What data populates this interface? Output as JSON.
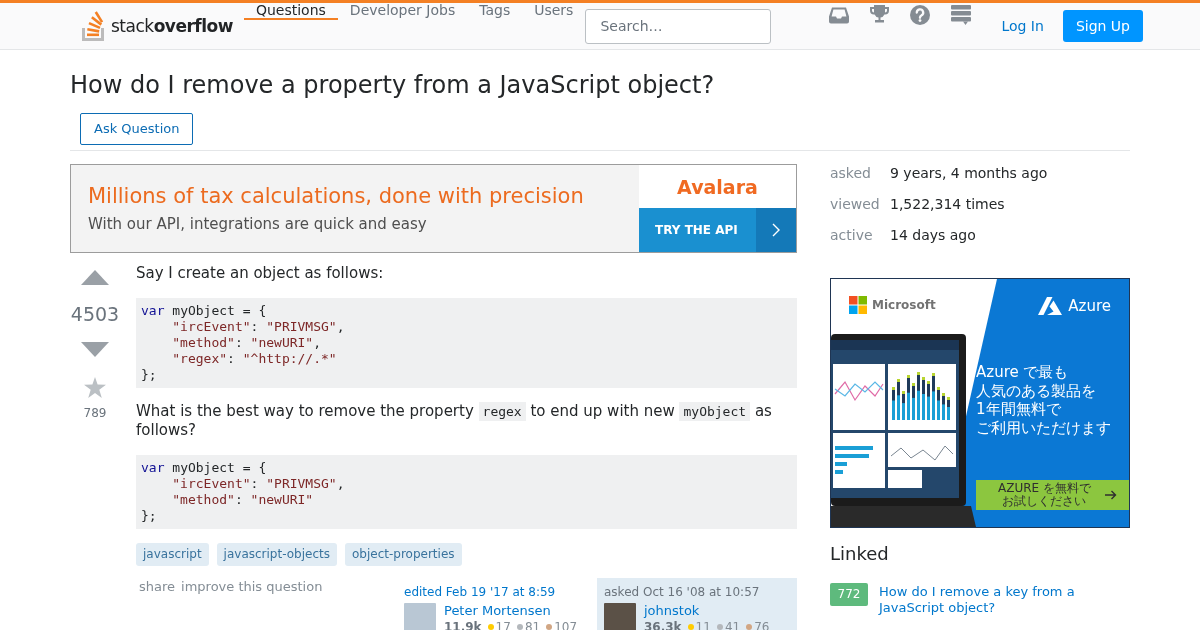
{
  "header": {
    "logo_text": "stack**overflow**",
    "nav": [
      {
        "label": "Questions",
        "selected": true
      },
      {
        "label": "Developer Jobs",
        "selected": false
      },
      {
        "label": "Tags",
        "selected": false
      },
      {
        "label": "Users",
        "selected": false
      }
    ],
    "search": {
      "placeholder": "Search…"
    },
    "login": "Log In",
    "signup": "Sign Up"
  },
  "question": {
    "title": "How do I remove a property from a JavaScript object?",
    "ask_button": "Ask Question"
  },
  "ad_banner": {
    "headline": "Millions of tax calculations, done with precision",
    "subline": "With our API, integrations are quick and easy",
    "brand": "Avalara",
    "cta": "TRY THE API"
  },
  "post": {
    "score": "4503",
    "favorite_count": "789",
    "body": [
      {
        "kind": "paragraph",
        "parts": [
          {
            "kind": "text",
            "text": "Say I create an object as follows:"
          }
        ]
      },
      {
        "kind": "code",
        "lines": [
          {
            "indent": false,
            "tokens": [
              {
                "kind": "keyword",
                "text": "var"
              },
              {
                "kind": "plain",
                "text": " myObject = {"
              }
            ]
          },
          {
            "indent": true,
            "tokens": [
              {
                "kind": "string",
                "text": "\"ircEvent\""
              },
              {
                "kind": "plain",
                "text": ": "
              },
              {
                "kind": "string",
                "text": "\"PRIVMSG\""
              },
              {
                "kind": "plain",
                "text": ","
              }
            ]
          },
          {
            "indent": true,
            "tokens": [
              {
                "kind": "string",
                "text": "\"method\""
              },
              {
                "kind": "plain",
                "text": ": "
              },
              {
                "kind": "string",
                "text": "\"newURI\""
              },
              {
                "kind": "plain",
                "text": ","
              }
            ]
          },
          {
            "indent": true,
            "tokens": [
              {
                "kind": "string",
                "text": "\"regex\""
              },
              {
                "kind": "plain",
                "text": ": "
              },
              {
                "kind": "string",
                "text": "\"^http://.*\""
              }
            ]
          },
          {
            "indent": false,
            "tokens": [
              {
                "kind": "plain",
                "text": "};"
              }
            ]
          }
        ]
      },
      {
        "kind": "paragraph",
        "parts": [
          {
            "kind": "text",
            "text": "What is the best way to remove the property "
          },
          {
            "kind": "code",
            "text": "regex"
          },
          {
            "kind": "text",
            "text": " to end up with new "
          },
          {
            "kind": "code",
            "text": "myObject"
          },
          {
            "kind": "text",
            "text": " as follows?"
          }
        ]
      },
      {
        "kind": "code",
        "lines": [
          {
            "indent": false,
            "tokens": [
              {
                "kind": "keyword",
                "text": "var"
              },
              {
                "kind": "plain",
                "text": " myObject = {"
              }
            ]
          },
          {
            "indent": true,
            "tokens": [
              {
                "kind": "string",
                "text": "\"ircEvent\""
              },
              {
                "kind": "plain",
                "text": ": "
              },
              {
                "kind": "string",
                "text": "\"PRIVMSG\""
              },
              {
                "kind": "plain",
                "text": ","
              }
            ]
          },
          {
            "indent": true,
            "tokens": [
              {
                "kind": "string",
                "text": "\"method\""
              },
              {
                "kind": "plain",
                "text": ": "
              },
              {
                "kind": "string",
                "text": "\"newURI\""
              }
            ]
          },
          {
            "indent": false,
            "tokens": [
              {
                "kind": "plain",
                "text": "};"
              }
            ]
          }
        ]
      }
    ],
    "tags": [
      "javascript",
      "javascript-objects",
      "object-properties"
    ],
    "menu": [
      "share",
      "improve this question"
    ],
    "user_cards": [
      {
        "kind": "editor",
        "action": "edited Feb 19 '17 at 8:59",
        "name": "Peter Mortensen",
        "reputation": "11.9k",
        "badges": [
          {
            "color": "#ffcc01",
            "count": "17"
          },
          {
            "color": "#b4b8bc",
            "count": "81"
          },
          {
            "color": "#d1a684",
            "count": "107"
          }
        ]
      },
      {
        "kind": "owner",
        "action": "asked Oct 16 '08 at 10:57",
        "name": "johnstok",
        "reputation": "36.3k",
        "badges": [
          {
            "color": "#ffcc01",
            "count": "11"
          },
          {
            "color": "#b4b8bc",
            "count": "41"
          },
          {
            "color": "#d1a684",
            "count": "76"
          }
        ]
      }
    ]
  },
  "sidebar": {
    "stats": [
      {
        "label": "asked",
        "value": "9 years, 4 months ago"
      },
      {
        "label": "viewed",
        "value": "1,522,314 times"
      },
      {
        "label": "active",
        "value": "14 days ago"
      }
    ],
    "ad": {
      "brand": "Microsoft",
      "product": "Azure",
      "headline_lines": [
        "Azure で最も",
        "人気のある製品を",
        "1年間無料で",
        "ご利用いただけます"
      ],
      "cta_lines": [
        "AZURE を無料で",
        "お試しください"
      ]
    },
    "linked": {
      "title": "Linked",
      "items": [
        {
          "score": "772",
          "title": "How do I remove a key from a JavaScript object?"
        }
      ]
    }
  }
}
